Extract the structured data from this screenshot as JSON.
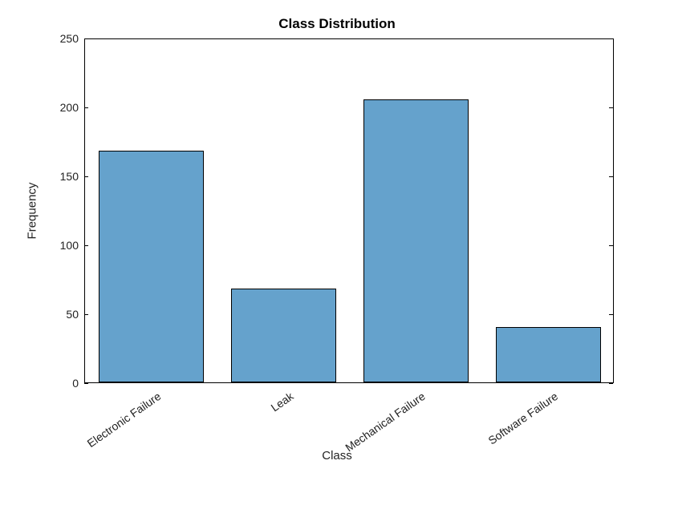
{
  "chart_data": {
    "type": "bar",
    "title": "Class Distribution",
    "xlabel": "Class",
    "ylabel": "Frequency",
    "categories": [
      "Electronic Failure",
      "Leak",
      "Mechanical Failure",
      "Software Failure"
    ],
    "values": [
      168,
      68,
      205,
      40
    ],
    "ylim": [
      0,
      250
    ],
    "yticks": [
      0,
      50,
      100,
      150,
      200,
      250
    ]
  }
}
